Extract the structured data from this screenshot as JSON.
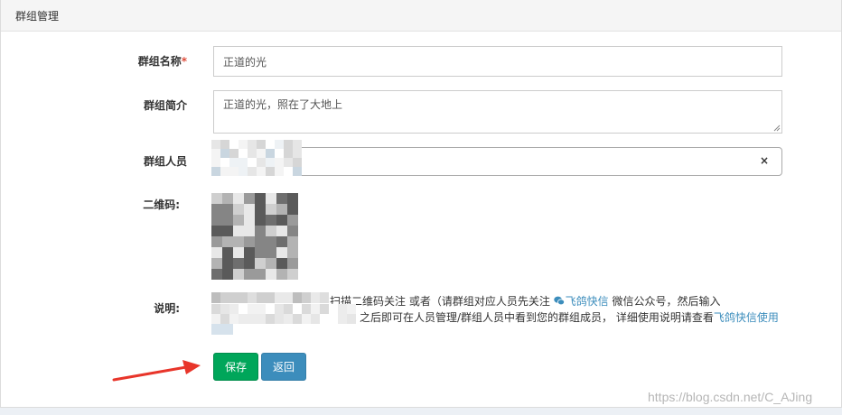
{
  "page": {
    "title": "群组管理"
  },
  "form": {
    "name_label": "群组名称",
    "name_required_mark": "*",
    "name_value": "正道的光",
    "intro_label": "群组简介",
    "intro_value": "正道的光，照在了大地上",
    "members_label": "群组人员",
    "members_clear": "×",
    "qrcode_label": "二维码:",
    "desc_label": "说明:",
    "desc_line1_a": "扫描二维码关注 或者（请群组对应人员先关注 ",
    "desc_line1_link": "飞鸽快信",
    "desc_line1_b": " 微信公众号，然后输入",
    "desc_line2_a": "之后即可在人员管理/群组人员中看到您的群组成员，  详细使用说明请查看",
    "desc_line2_link": "飞鸽快信使用"
  },
  "buttons": {
    "save": "保存",
    "back": "返回"
  },
  "watermark": "https://blog.csdn.net/C_AJing",
  "colors": {
    "save": "#00a65a",
    "back": "#3c8dbc",
    "link": "#3c8dbc",
    "required": "#dd4b39",
    "arrow": "#e8352a"
  }
}
